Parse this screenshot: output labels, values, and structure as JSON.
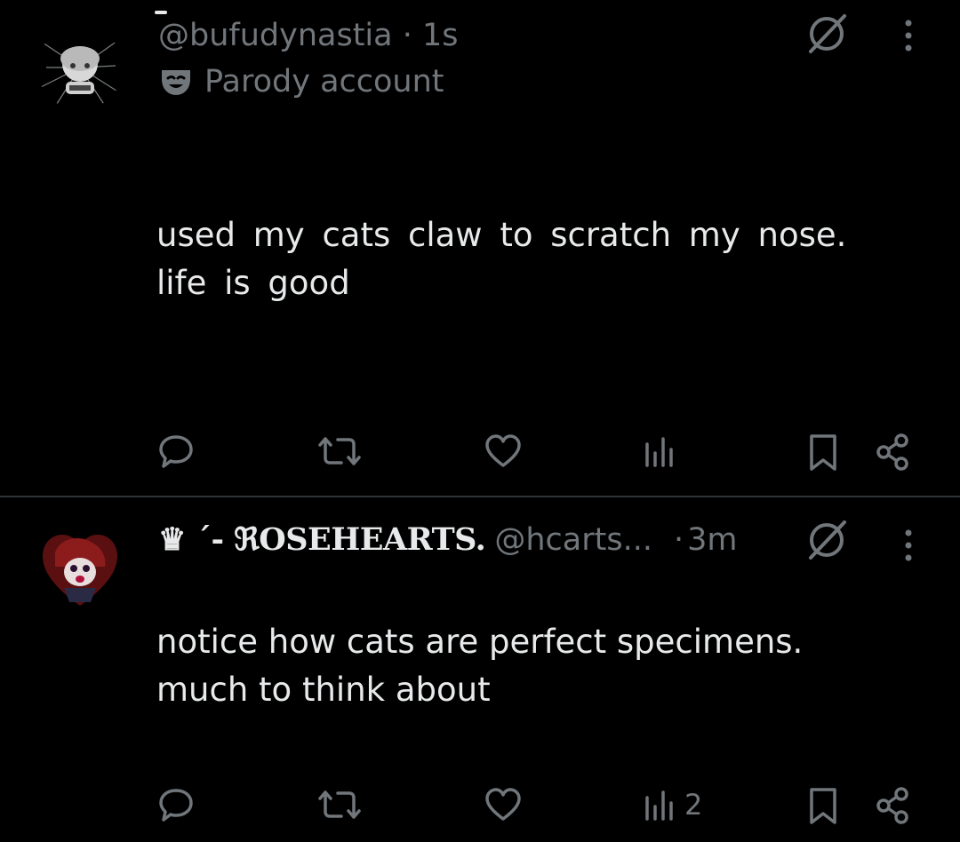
{
  "posts": [
    {
      "handle": "@bufudynastia",
      "separator": "·",
      "time": "1s",
      "badge_label": "Parody account",
      "text": "used my cats claw to scratch my nose.\nlife is good",
      "stats": {
        "replies": "",
        "reposts": "",
        "likes": "",
        "views": ""
      }
    },
    {
      "display_name": "♛ ´- ℜOSEHEARTS.",
      "handle": "@hcarts...",
      "separator": "·",
      "time": "3m",
      "text": "notice how cats are perfect specimens.\nmuch to think about",
      "stats": {
        "replies": "",
        "reposts": "",
        "likes": "",
        "views": "2"
      }
    }
  ],
  "icons": {
    "reply": "speech-bubble-icon",
    "repost": "repost-arrows-icon",
    "like": "heart-icon",
    "views": "bar-chart-icon",
    "bookmark": "bookmark-icon",
    "share": "share-nodes-icon",
    "grok": "grok-slash-circle-icon",
    "more": "vertical-dots-icon",
    "parody": "theater-mask-icon"
  },
  "colors": {
    "background": "#000000",
    "primary_text": "#e7e9ea",
    "secondary_text": "#71767b",
    "divider": "#2f3336"
  }
}
